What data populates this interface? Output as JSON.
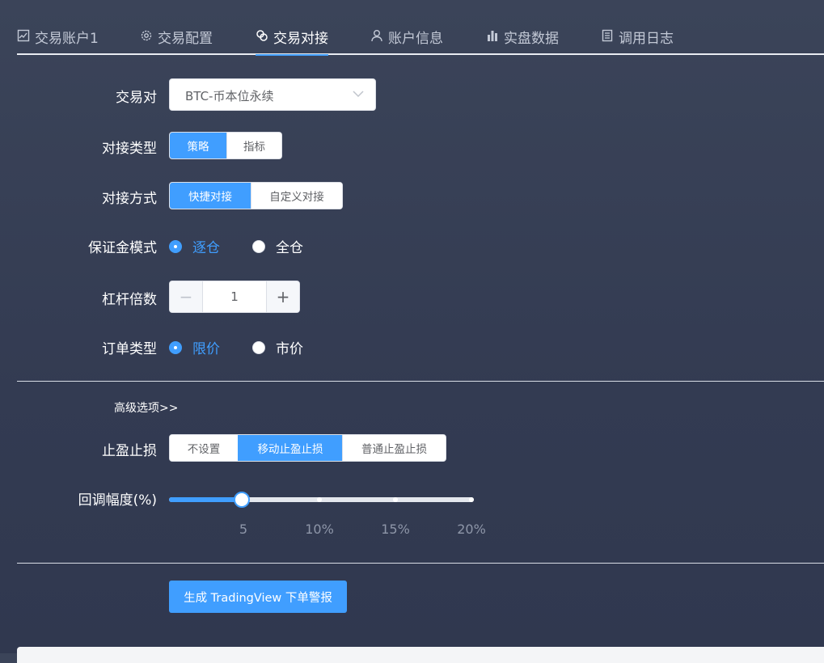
{
  "tabs": [
    {
      "label": "交易账户1",
      "icon": "line-chart-icon"
    },
    {
      "label": "交易配置",
      "icon": "gear-icon"
    },
    {
      "label": "交易对接",
      "icon": "link-icon"
    },
    {
      "label": "账户信息",
      "icon": "user-icon"
    },
    {
      "label": "实盘数据",
      "icon": "bar-chart-icon"
    },
    {
      "label": "调用日志",
      "icon": "document-icon"
    }
  ],
  "active_tab": "交易对接",
  "form": {
    "pair": {
      "label": "交易对",
      "value": "BTC-币本位永续"
    },
    "dock_type": {
      "label": "对接类型",
      "options": [
        "策略",
        "指标"
      ],
      "selected": "策略"
    },
    "dock_mode": {
      "label": "对接方式",
      "options": [
        "快捷对接",
        "自定义对接"
      ],
      "selected": "快捷对接"
    },
    "margin_mode": {
      "label": "保证金模式",
      "options": [
        "逐仓",
        "全仓"
      ],
      "selected": "逐仓"
    },
    "leverage": {
      "label": "杠杆倍数",
      "value": "1",
      "minus": "−",
      "plus": "+"
    },
    "order_type": {
      "label": "订单类型",
      "options": [
        "限价",
        "市价"
      ],
      "selected": "限价"
    }
  },
  "advanced": {
    "toggle_label": "高级选项>>",
    "tp_sl": {
      "label": "止盈止损",
      "options": [
        "不设置",
        "移动止盈止损",
        "普通止盈止损"
      ],
      "selected": "移动止盈止损"
    },
    "pullback": {
      "label": "回调幅度(%)",
      "value_fraction": 0.24,
      "marks": [
        "5",
        "10%",
        "15%",
        "20%"
      ]
    }
  },
  "generate_button": "生成 TradingView 下单警报",
  "colors": {
    "accent": "#409eff",
    "background": "#363e55",
    "text": "#ffffff"
  }
}
